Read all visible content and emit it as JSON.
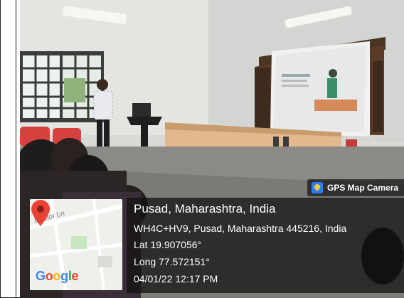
{
  "camera_tag": {
    "label": "GPS Map Camera",
    "icon": "gps-map-camera-icon"
  },
  "location": {
    "title": "Pusad, Maharashtra, India",
    "address": "WH4C+HV9, Pusad, Maharashtra 445216, India",
    "latitude": "Lat 19.907056°",
    "longitude": "Long 77.572151°",
    "datetime": "04/01/22 12:17 PM"
  },
  "map": {
    "street_label": "Doctor Ln",
    "logo_letters": [
      {
        "ch": "G",
        "color": "#4285F4"
      },
      {
        "ch": "o",
        "color": "#EA4335"
      },
      {
        "ch": "o",
        "color": "#FBBC05"
      },
      {
        "ch": "g",
        "color": "#4285F4"
      },
      {
        "ch": "l",
        "color": "#34A853"
      },
      {
        "ch": "e",
        "color": "#EA4335"
      }
    ],
    "pin_color": "#EA4335"
  }
}
